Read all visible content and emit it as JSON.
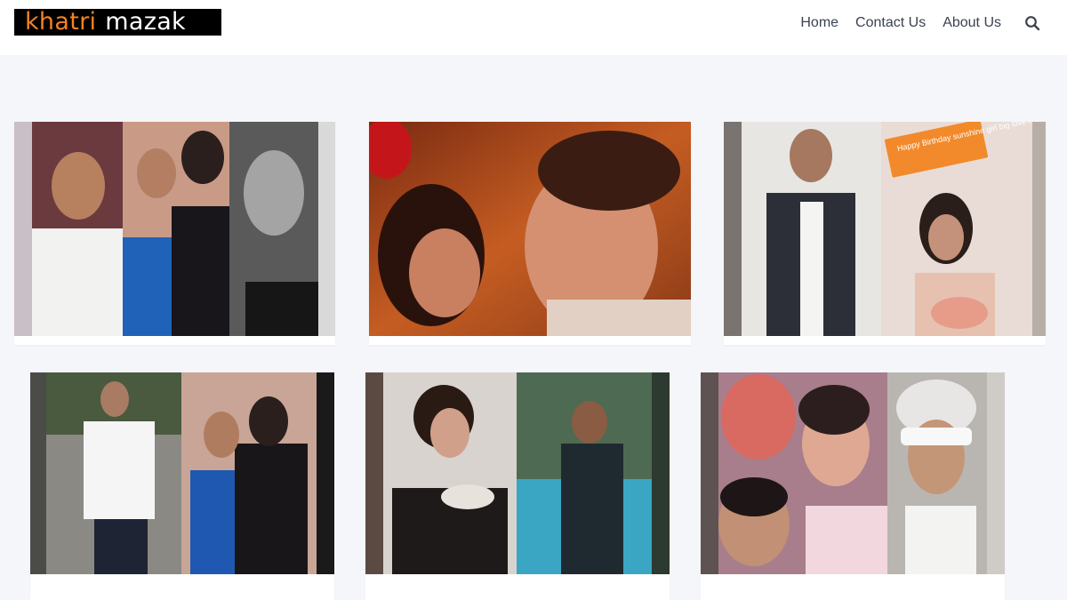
{
  "site": {
    "logo_part1": "khatri",
    "logo_part2": "mazak",
    "brand_color": "#f5821f"
  },
  "nav": {
    "items": [
      "Home",
      "Contact Us",
      "About Us"
    ],
    "search_icon": "search-icon"
  },
  "posts": [
    {
      "thumb_icon": "photo-collage-icon"
    },
    {
      "thumb_icon": "movie-still-icon"
    },
    {
      "thumb_icon": "photo-collage-icon"
    },
    {
      "thumb_icon": "photo-collage-icon"
    },
    {
      "thumb_icon": "photo-collage-icon"
    },
    {
      "thumb_icon": "photo-collage-icon",
      "overlay_text": ""
    }
  ],
  "birthday_overlay": {
    "text": "Happy Birthday sunshine girl big love n hug"
  }
}
